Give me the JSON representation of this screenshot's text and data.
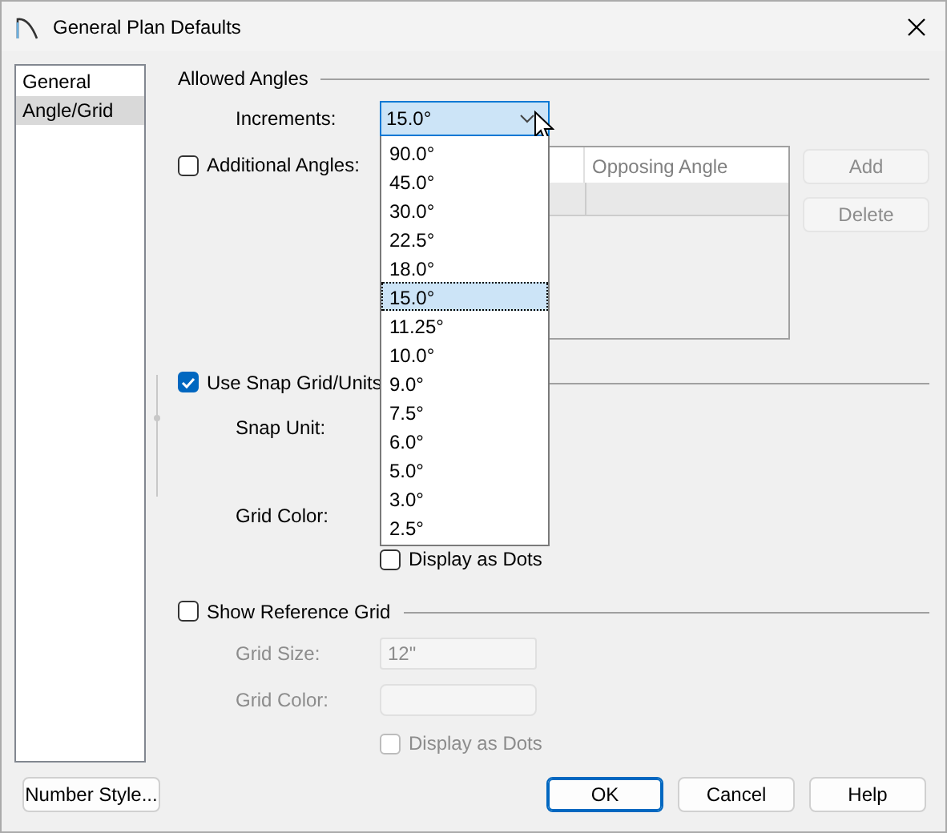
{
  "window": {
    "title": "General Plan Defaults"
  },
  "sidebar": {
    "items": [
      {
        "label": "General",
        "selected": false
      },
      {
        "label": "Angle/Grid",
        "selected": true
      }
    ]
  },
  "allowed_angles": {
    "title": "Allowed Angles",
    "increments": {
      "label": "Increments:",
      "value": "15.0°",
      "expanded": true,
      "options": [
        {
          "label": "90.0°",
          "selected": false
        },
        {
          "label": "45.0°",
          "selected": false
        },
        {
          "label": "30.0°",
          "selected": false
        },
        {
          "label": "22.5°",
          "selected": false
        },
        {
          "label": "18.0°",
          "selected": false
        },
        {
          "label": "15.0°",
          "selected": true
        },
        {
          "label": "11.25°",
          "selected": false
        },
        {
          "label": "10.0°",
          "selected": false
        },
        {
          "label": "9.0°",
          "selected": false
        },
        {
          "label": "7.5°",
          "selected": false
        },
        {
          "label": "6.0°",
          "selected": false
        },
        {
          "label": "5.0°",
          "selected": false
        },
        {
          "label": "3.0°",
          "selected": false
        },
        {
          "label": "2.5°",
          "selected": false
        }
      ]
    },
    "additional_angles": {
      "label": "Additional Angles:",
      "checked": false
    },
    "table": {
      "columns": [
        "Opposing Angle"
      ]
    },
    "buttons": [
      {
        "label": "Add",
        "disabled": true
      },
      {
        "label": "Delete",
        "disabled": true
      }
    ]
  },
  "snap_grid": {
    "label": "Use Snap Grid/Units",
    "checked": true,
    "snap_unit_label": "Snap Unit:",
    "grid_color_label": "Grid Color:",
    "display_as_dots": {
      "label": "Display as Dots",
      "checked": false
    }
  },
  "reference_grid": {
    "label": "Show Reference Grid",
    "checked": false,
    "disabled": true,
    "grid_size": {
      "label": "Grid Size:",
      "value": "12\""
    },
    "grid_color": {
      "label": "Grid Color:"
    },
    "display_as_dots": {
      "label": "Display as Dots",
      "checked": false
    }
  },
  "footer": {
    "buttons": [
      {
        "label": "Number Style...",
        "default": false
      },
      {
        "label": "OK",
        "default": true
      },
      {
        "label": "Cancel",
        "default": false
      },
      {
        "label": "Help",
        "default": false
      }
    ]
  }
}
